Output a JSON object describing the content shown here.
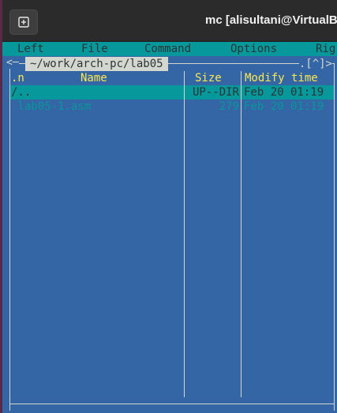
{
  "window": {
    "title": "mc [alisultani@VirtualB",
    "new_tab_icon": "new-tab-icon"
  },
  "menubar": {
    "left": "Left",
    "file": "File",
    "command": "Command",
    "options": "Options",
    "right": "Rig"
  },
  "panel": {
    "path": "~/work/arch-pc/lab05",
    "scroll_indicator": ".[^]>",
    "columns": {
      "sort": ".n",
      "name": "Name",
      "size": "Size",
      "modify": "Modify time"
    },
    "rows": [
      {
        "name": "/..",
        "size": "UP--DIR",
        "modified": "Feb 20 01:19",
        "selected": true
      },
      {
        "name": " lab05-1.asm",
        "size": "279",
        "modified": "Feb 20 01:19",
        "selected": false
      }
    ]
  },
  "colors": {
    "panel_bg": "#3465a4",
    "selection_bg": "#06989a",
    "header_fg": "#fce94f",
    "file_fg": "#06989a"
  }
}
